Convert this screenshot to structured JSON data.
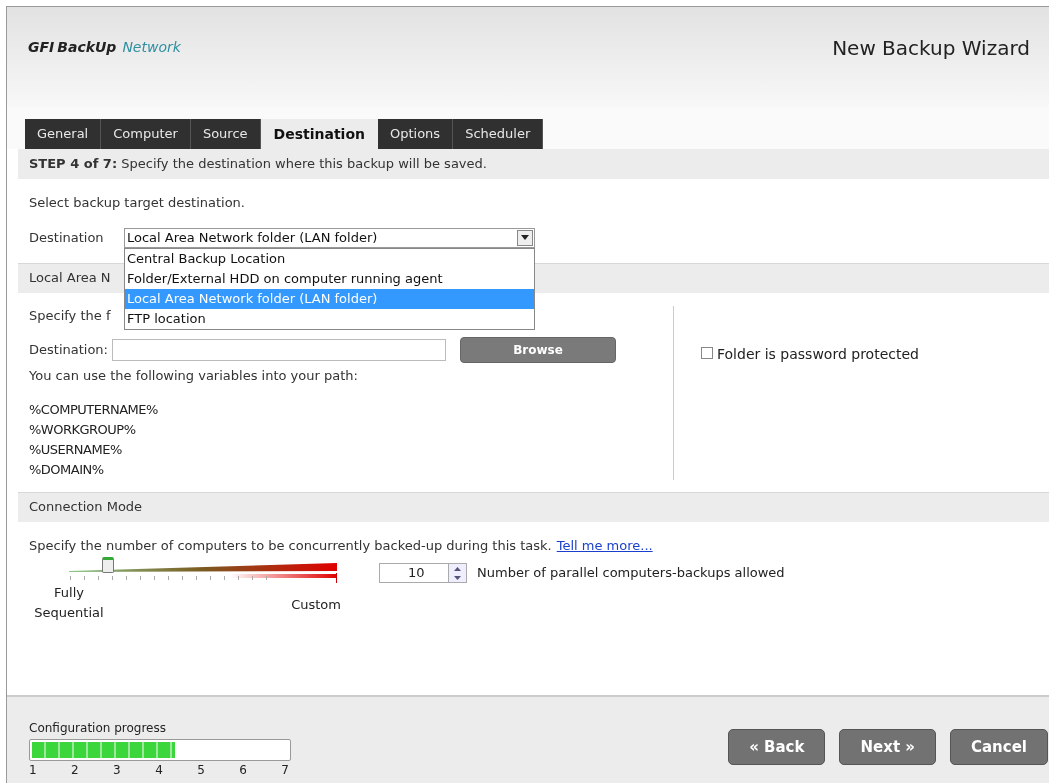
{
  "header": {
    "logo_brand": "GFI",
    "logo_product": "BackUp",
    "logo_suffix": "Network",
    "title": "New Backup Wizard"
  },
  "tabs": [
    {
      "label": "General",
      "selected": false
    },
    {
      "label": "Computer",
      "selected": false
    },
    {
      "label": "Source",
      "selected": false
    },
    {
      "label": "Destination",
      "selected": true
    },
    {
      "label": "Options",
      "selected": false
    },
    {
      "label": "Scheduler",
      "selected": false
    }
  ],
  "step": {
    "label": "STEP 4 of 7:",
    "text": "Specify the destination where this backup will be saved."
  },
  "target": {
    "intro": "Select backup target destination.",
    "label": "Destination",
    "value": "Local Area Network folder (LAN folder)",
    "options": [
      {
        "label": "Central Backup Location",
        "selected": false
      },
      {
        "label": "Folder/External HDD on computer running agent",
        "selected": false
      },
      {
        "label": "Local Area Network folder (LAN folder)",
        "selected": true
      },
      {
        "label": "FTP location",
        "selected": false
      }
    ]
  },
  "lan_section": {
    "heading": "Local Area N",
    "intro": "Specify the f",
    "field_label": "Destination:",
    "browse": "Browse",
    "hint": "You can use the following variables into your path:",
    "variables": [
      "%COMPUTERNAME%",
      "%WORKGROUP%",
      "%USERNAME%",
      "%DOMAIN%"
    ],
    "password": {
      "label": "Folder is password protected",
      "checked": false
    }
  },
  "connection": {
    "heading": "Connection Mode",
    "text": "Specify the number of computers to be concurrently backed-up during this task.",
    "link": "Tell me more...",
    "slider": {
      "level": 0.14,
      "min_label": "Fully Sequential",
      "max_label": "Custom"
    },
    "count": "10",
    "count_label": "Number of parallel computers-backups allowed"
  },
  "footer": {
    "progress_label": "Configuration progress",
    "progress": {
      "level": 0.56
    },
    "ticks": [
      "1",
      "2",
      "3",
      "4",
      "5",
      "6",
      "7"
    ],
    "buttons": [
      "« Back",
      "Next »",
      "Cancel"
    ]
  }
}
